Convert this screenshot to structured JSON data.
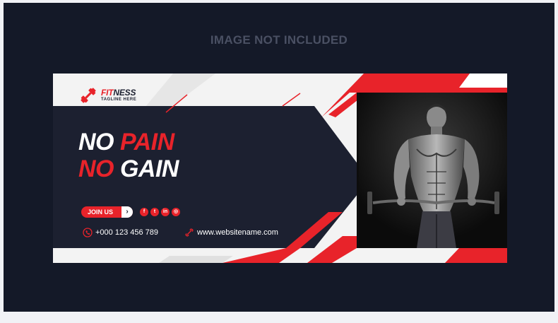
{
  "watermark": "IMAGE NOT INCLUDED",
  "logo": {
    "brand_first": "FIT",
    "brand_second": "NESS",
    "tagline": "TAGLINE HERE",
    "icon": "dumbbell-icon"
  },
  "headline": {
    "line1_white": "NO ",
    "line1_red": "PAIN",
    "line2_red": "NO ",
    "line2_white": "GAIN"
  },
  "cta": {
    "label": "JOIN US",
    "arrow": "›"
  },
  "social": [
    {
      "name": "facebook-icon",
      "glyph": "f"
    },
    {
      "name": "twitter-icon",
      "glyph": "t"
    },
    {
      "name": "linkedin-icon",
      "glyph": "in"
    },
    {
      "name": "instagram-icon",
      "glyph": "◎"
    }
  ],
  "contact": {
    "phone": "+000 123 456 789",
    "website": "www.websitename.com"
  },
  "colors": {
    "accent": "#e8232a",
    "dark": "#1c2030",
    "stage": "#141928",
    "light": "#f2f2f2"
  }
}
